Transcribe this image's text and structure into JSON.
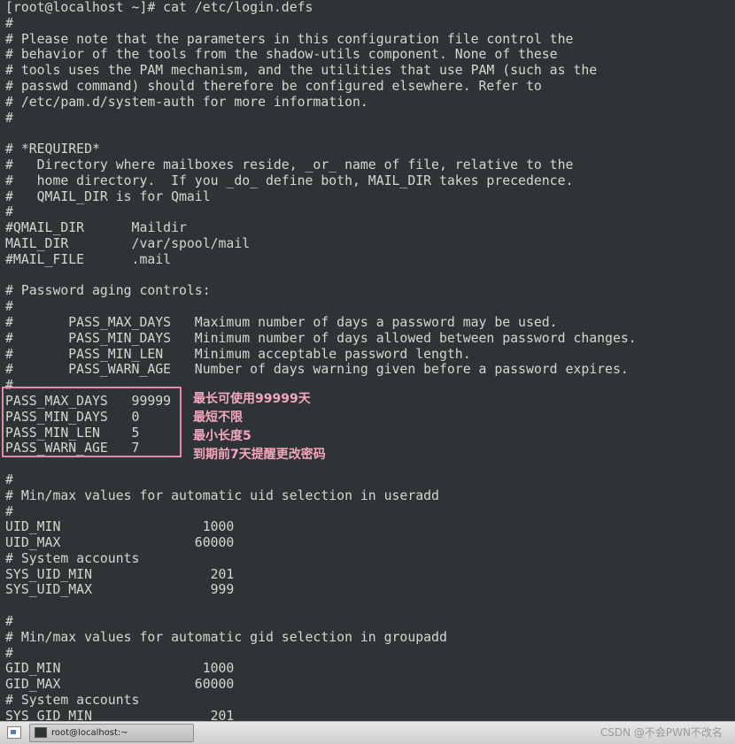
{
  "terminal": {
    "lines": [
      "[root@localhost ~]# cat /etc/login.defs",
      "#",
      "# Please note that the parameters in this configuration file control the",
      "# behavior of the tools from the shadow-utils component. None of these",
      "# tools uses the PAM mechanism, and the utilities that use PAM (such as the",
      "# passwd command) should therefore be configured elsewhere. Refer to",
      "# /etc/pam.d/system-auth for more information.",
      "#",
      "",
      "# *REQUIRED*",
      "#   Directory where mailboxes reside, _or_ name of file, relative to the",
      "#   home directory.  If you _do_ define both, MAIL_DIR takes precedence.",
      "#   QMAIL_DIR is for Qmail",
      "#",
      "#QMAIL_DIR      Maildir",
      "MAIL_DIR        /var/spool/mail",
      "#MAIL_FILE      .mail",
      "",
      "# Password aging controls:",
      "#",
      "#       PASS_MAX_DAYS   Maximum number of days a password may be used.",
      "#       PASS_MIN_DAYS   Minimum number of days allowed between password changes.",
      "#       PASS_MIN_LEN    Minimum acceptable password length.",
      "#       PASS_WARN_AGE   Number of days warning given before a password expires.",
      "#",
      "PASS_MAX_DAYS   99999",
      "PASS_MIN_DAYS   0",
      "PASS_MIN_LEN    5",
      "PASS_WARN_AGE   7",
      "",
      "#",
      "# Min/max values for automatic uid selection in useradd",
      "#",
      "UID_MIN                  1000",
      "UID_MAX                 60000",
      "# System accounts",
      "SYS_UID_MIN               201",
      "SYS_UID_MAX               999",
      "",
      "#",
      "# Min/max values for automatic gid selection in groupadd",
      "#",
      "GID_MIN                  1000",
      "GID_MAX                 60000",
      "# System accounts",
      "SYS_GID_MIN               201"
    ]
  },
  "annotations": [
    "最长可使用99999天",
    "最短不限",
    "最小长度5",
    "到期前7天提醒更改密码"
  ],
  "taskbar": {
    "task_label": "root@localhost:~",
    "watermark": "CSDN @不会PWN不改名"
  },
  "colors": {
    "terminal_bg": "#2e3436",
    "terminal_fg": "#d3d7cf",
    "annotation": "#f4a6c0",
    "highlight_border": "#e38aa8"
  },
  "icons": {
    "show_desktop": "show-desktop-icon",
    "terminal_app": "terminal-icon"
  }
}
